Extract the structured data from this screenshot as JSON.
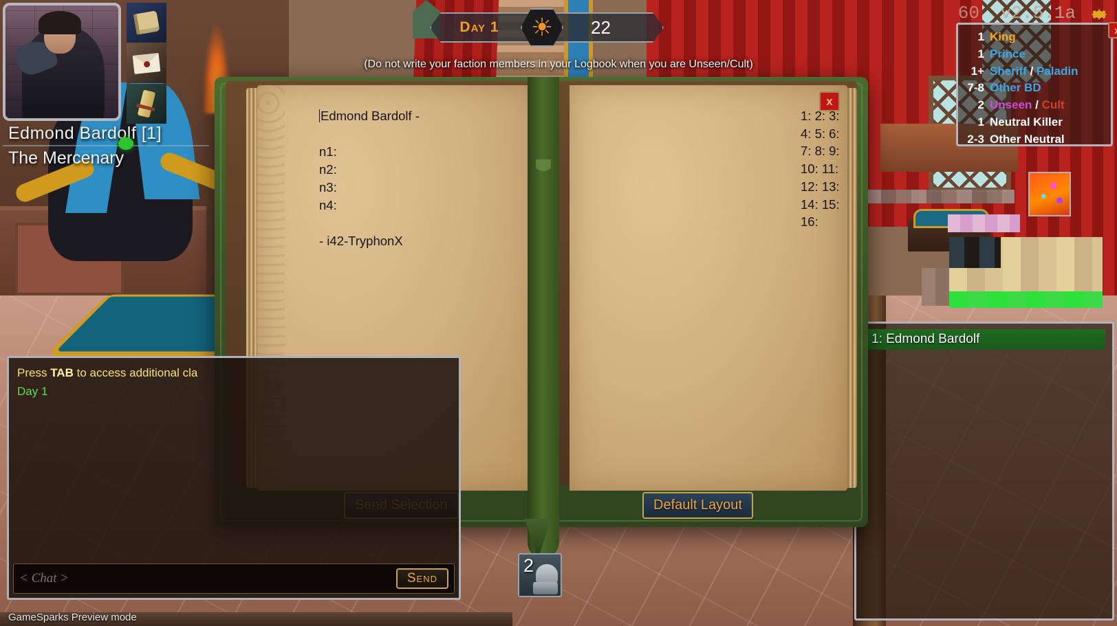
{
  "hud": {
    "day_label": "Day 1",
    "timer": "22",
    "sun_icon": "sun-icon",
    "faction_warning": "(Do not write your faction members in your Logbook when you are Unseen/Cult)",
    "fps": "60",
    "version": "v2.5.1a",
    "settings_icon": "gear-icon"
  },
  "player_card": {
    "name": "Edmond Bardolf [1]",
    "role": "The Mercenary",
    "items": [
      {
        "icon": "book-icon",
        "name": "logbook-item"
      },
      {
        "icon": "letter-icon",
        "name": "letter-item"
      },
      {
        "icon": "scroll-icon",
        "name": "scroll-item"
      }
    ]
  },
  "role_panel": {
    "close_label": "x",
    "rows": [
      {
        "count": "1",
        "text": "King",
        "color": "#f2a81e"
      },
      {
        "count": "1",
        "text": "Prince",
        "color": "#3aa8e8"
      },
      {
        "count": "1+",
        "text": "Sheriff / Paladin",
        "color": "#3aa8e8"
      },
      {
        "count": "7-8",
        "text": "Other BD",
        "color": "#3aa8e8"
      },
      {
        "count": "2",
        "text": "Unseen / Cult",
        "color": "#c64fd8"
      },
      {
        "count": "1",
        "text": "Neutral Killer",
        "color": "#ffffff"
      },
      {
        "count": "2-3",
        "text": "Other Neutral",
        "color": "#ffffff"
      }
    ]
  },
  "logbook": {
    "close_label": "x",
    "left_page_text": "Edmond Bardolf -\n\nn1:\nn2:\nn3:\nn4:\n\n- i42-TryphonX",
    "right_page_numbers": "1:\n2:\n3:\n4:\n5:\n6:\n7:\n8:\n9:\n10:\n11:\n12:\n13:\n14:\n15:\n16:",
    "send_selection_label": "Send Selection",
    "default_layout_label": "Default Layout"
  },
  "item_slot": {
    "quantity": "2",
    "icon": "helmet-icon"
  },
  "chat": {
    "lines": [
      {
        "prefix": "Press ",
        "bold": "TAB",
        "suffix": " to access additional cla",
        "style": "yellow"
      },
      {
        "prefix": "Day 1",
        "bold": "",
        "suffix": "",
        "style": "green"
      }
    ],
    "placeholder": "< Chat >",
    "value": "",
    "send_label": "Send"
  },
  "player_list": {
    "rows": [
      {
        "label": "1: Edmond Bardolf"
      }
    ]
  },
  "footer": {
    "preview_mode": "GameSparks Preview mode"
  },
  "colors": {
    "gold": "#efa740",
    "panel_border": "#b2b6bc",
    "close_red": "#c0161a",
    "highlight_green": "#1e6b20"
  }
}
